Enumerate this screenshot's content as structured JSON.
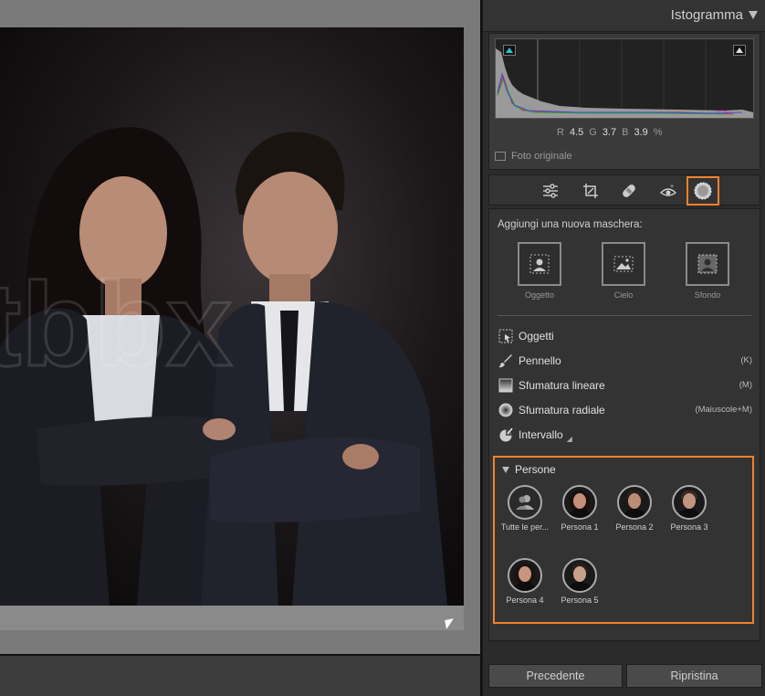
{
  "histogram": {
    "title": "Istogramma",
    "r_label": "R",
    "r_value": "4.5",
    "g_label": "G",
    "g_value": "3.7",
    "b_label": "B",
    "b_value": "3.9",
    "unit": "%",
    "original_photo_label": "Foto originale"
  },
  "tools": [
    "sliders-icon",
    "crop-icon",
    "healing-icon",
    "redeye-icon",
    "masking-icon"
  ],
  "mask": {
    "title": "Aggiungi una nuova maschera:",
    "quick_masks": [
      {
        "label": "Oggetto",
        "icon": "subject-icon"
      },
      {
        "label": "Cielo",
        "icon": "sky-icon"
      },
      {
        "label": "Sfondo",
        "icon": "background-icon"
      }
    ],
    "options": [
      {
        "label": "Oggetti",
        "shortcut": "",
        "icon": "objects-icon"
      },
      {
        "label": "Pennello",
        "shortcut": "(K)",
        "icon": "brush-icon"
      },
      {
        "label": "Sfumatura lineare",
        "shortcut": "(M)",
        "icon": "linear-gradient-icon"
      },
      {
        "label": "Sfumatura radiale",
        "shortcut": "(Maiuscole+M)",
        "icon": "radial-gradient-icon"
      },
      {
        "label": "Intervallo",
        "shortcut": "",
        "icon": "range-icon"
      }
    ]
  },
  "people": {
    "title": "Persone",
    "items": [
      {
        "label": "Tutte le per..."
      },
      {
        "label": "Persona 1"
      },
      {
        "label": "Persona 2"
      },
      {
        "label": "Persona 3"
      },
      {
        "label": "Persona 4"
      },
      {
        "label": "Persona 5"
      }
    ]
  },
  "buttons": {
    "previous": "Precedente",
    "reset": "Ripristina"
  },
  "colors": {
    "accent": "#f0822d",
    "panel": "#333333"
  }
}
